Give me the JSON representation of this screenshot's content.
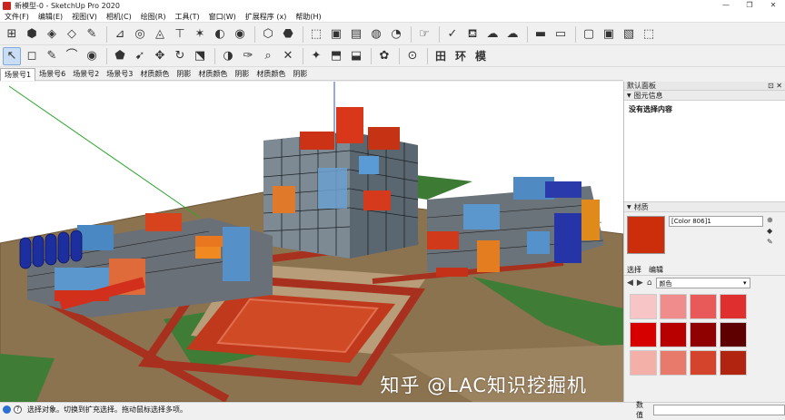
{
  "window": {
    "title": "新模型-0 - SketchUp Pro 2020",
    "controls": [
      "—",
      "❐",
      "✕"
    ]
  },
  "menu": [
    "文件(F)",
    "编辑(E)",
    "视图(V)",
    "相机(C)",
    "绘图(R)",
    "工具(T)",
    "窗口(W)",
    "扩展程序 (x)",
    "帮助(H)"
  ],
  "toolbar1": {
    "groups": [
      [
        "⊞",
        "⬢",
        "◈",
        "◇",
        "✎"
      ],
      [
        "⊿",
        "◎",
        "◬",
        "⊤",
        "✶",
        "◐",
        "◉"
      ],
      [
        "⬡",
        "⬣"
      ],
      [
        "⬚",
        "▣",
        "▤",
        "◍",
        "◔"
      ],
      [
        "☞"
      ],
      [
        "✓",
        "⛾",
        "☁",
        "☁"
      ],
      [
        "▬",
        "▭"
      ],
      [
        "▢",
        "▣",
        "▧",
        "⬚"
      ]
    ]
  },
  "toolbar2": {
    "groups": [
      [
        "↖",
        "◻",
        "✎",
        "⌒",
        "◉"
      ],
      [
        "⬟",
        "➹",
        "✥",
        "↻",
        "⬔"
      ],
      [
        "◑",
        "✑",
        "⌕",
        "✕"
      ],
      [
        "✦",
        "⬒",
        "⬓"
      ],
      [
        "✿"
      ],
      [
        "⊙"
      ],
      [
        "田",
        "环",
        "模"
      ]
    ],
    "selected_index": 0
  },
  "scenes": [
    "场景号1",
    "场景号6",
    "场景号2",
    "场景号3",
    "材质颜色",
    "阴影",
    "材质颜色",
    "阴影",
    "材质颜色",
    "阴影"
  ],
  "tray": {
    "title": "默认面板",
    "entity_info": {
      "header": "图元信息",
      "empty_text": "没有选择内容"
    },
    "materials": {
      "header": "材质",
      "name": "[Color 806]1",
      "swatch_color": "#cc2e0c",
      "tabs": [
        "选择",
        "编辑"
      ],
      "collection": "颜色",
      "colors": [
        "#f7c5c5",
        "#f08c8c",
        "#e85a5a",
        "#e02f2f",
        "#d60000",
        "#b80000",
        "#8f0000",
        "#5e0000",
        "#f3b0a8",
        "#e77a6a",
        "#d4442c",
        "#b02410"
      ]
    }
  },
  "status": {
    "text": "选择对象。切换到扩充选择。拖动鼠标选择多项。",
    "measure_label": "数值"
  },
  "watermark": "知乎 @LAC知识挖掘机"
}
